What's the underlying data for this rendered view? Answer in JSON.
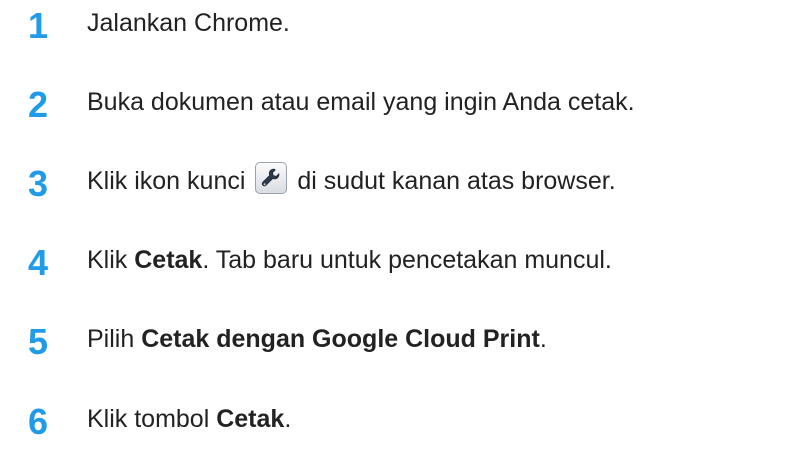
{
  "steps": [
    {
      "number": "1",
      "text": "Jalankan Chrome."
    },
    {
      "number": "2",
      "text": "Buka dokumen atau email yang ingin Anda cetak."
    },
    {
      "number": "3",
      "before_icon": "Klik ikon kunci",
      "icon": "wrench-icon",
      "after_icon": "di sudut kanan atas browser."
    },
    {
      "number": "4",
      "label_prefix": "Klik ",
      "bold": "Cetak",
      "label_suffix": ". Tab baru untuk pencetakan muncul."
    },
    {
      "number": "5",
      "label_prefix": "Pilih ",
      "bold": "Cetak dengan Google Cloud Print",
      "label_suffix": "."
    },
    {
      "number": "6",
      "label_prefix": "Klik tombol ",
      "bold": "Cetak",
      "label_suffix": "."
    }
  ],
  "colors": {
    "step_number": "#1f9be8",
    "text": "#222222"
  }
}
